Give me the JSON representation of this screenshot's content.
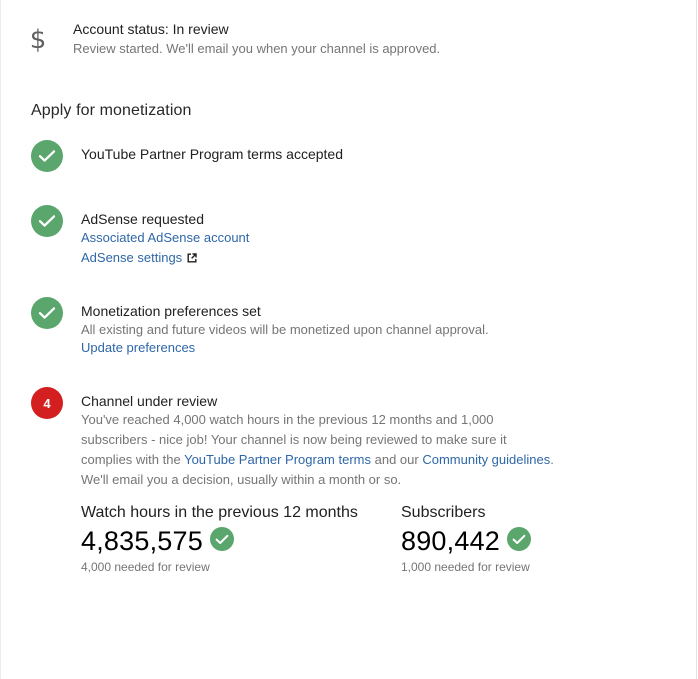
{
  "account_status": {
    "icon": "dollar-icon",
    "title": "Account status: In review",
    "subtitle": "Review started. We'll email you when your channel is approved."
  },
  "apply": {
    "title": "Apply for monetization",
    "steps": [
      {
        "title": "YouTube Partner Program terms accepted",
        "state": "done"
      },
      {
        "title": "AdSense requested",
        "state": "done",
        "link1": "Associated AdSense account",
        "link2": "AdSense settings"
      },
      {
        "title": "Monetization preferences set",
        "state": "done",
        "text": "All existing and future videos will be monetized upon channel approval.",
        "link1": "Update preferences"
      },
      {
        "title": "Channel under review",
        "state": "pending",
        "number": "4",
        "text_line1": "You've reached 4,000 watch hours in the previous 12 months and 1,000",
        "text_line2": "subscribers - nice job! Your channel is now being reviewed to make sure it",
        "text_line3_pre": "complies with the ",
        "text_line3_link1": "YouTube Partner Program terms",
        "text_line3_mid": " and our ",
        "text_line3_link2": "Community guidelines",
        "text_line3_post": ".",
        "text_line4": "We'll email you a decision, usually within a month or so."
      }
    ]
  },
  "stats": {
    "watch_hours": {
      "label": "Watch hours in the previous 12 months",
      "value": "4,835,575",
      "sub": "4,000 needed for review"
    },
    "subscribers": {
      "label": "Subscribers",
      "value": "890,442",
      "sub": "1,000 needed for review"
    }
  },
  "colors": {
    "check_green": "#5aa66c",
    "pending_red": "#d31f1f",
    "link_blue": "#2e67a8"
  }
}
